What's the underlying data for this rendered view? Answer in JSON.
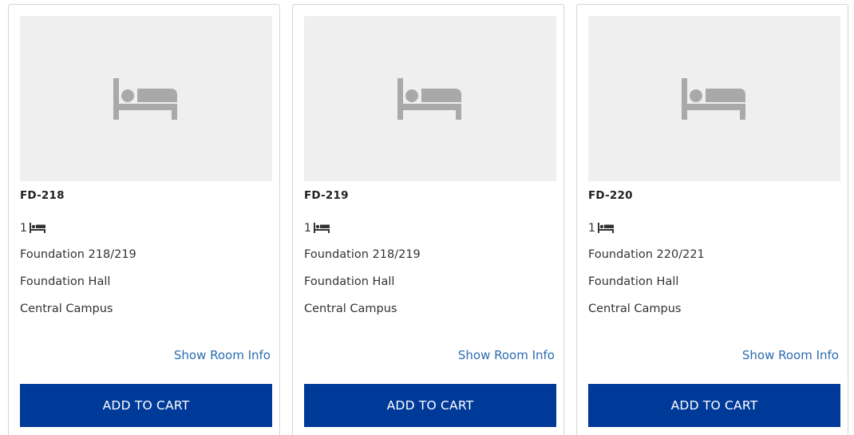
{
  "rooms": [
    {
      "name": "FD-218",
      "beds": "1",
      "room_group": "Foundation 218/219",
      "hall": "Foundation Hall",
      "campus": "Central Campus",
      "info_label": "Show Room Info",
      "cart_label": "ADD TO CART"
    },
    {
      "name": "FD-219",
      "beds": "1",
      "room_group": "Foundation 218/219",
      "hall": "Foundation Hall",
      "campus": "Central Campus",
      "info_label": "Show Room Info",
      "cart_label": "ADD TO CART"
    },
    {
      "name": "FD-220",
      "beds": "1",
      "room_group": "Foundation 220/221",
      "hall": "Foundation Hall",
      "campus": "Central Campus",
      "info_label": "Show Room Info",
      "cart_label": "ADD TO CART"
    }
  ],
  "icons": {
    "placeholder": "bed-icon",
    "beds": "bed-icon"
  },
  "colors": {
    "button_bg": "#003a99",
    "button_text": "#ffffff",
    "link": "#2b6cb0",
    "placeholder_bg": "#efefef",
    "placeholder_icon": "#a9a9a9"
  }
}
